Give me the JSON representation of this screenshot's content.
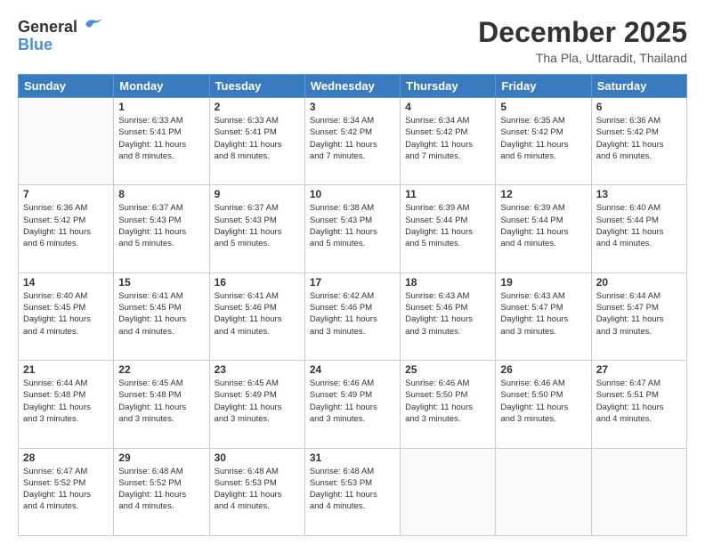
{
  "header": {
    "logo": {
      "general": "General",
      "blue": "Blue"
    },
    "title": "December 2025",
    "subtitle": "Tha Pla, Uttaradit, Thailand"
  },
  "calendar": {
    "days_of_week": [
      "Sunday",
      "Monday",
      "Tuesday",
      "Wednesday",
      "Thursday",
      "Friday",
      "Saturday"
    ],
    "weeks": [
      [
        {
          "day": "",
          "info": ""
        },
        {
          "day": "1",
          "info": "Sunrise: 6:33 AM\nSunset: 5:41 PM\nDaylight: 11 hours\nand 8 minutes."
        },
        {
          "day": "2",
          "info": "Sunrise: 6:33 AM\nSunset: 5:41 PM\nDaylight: 11 hours\nand 8 minutes."
        },
        {
          "day": "3",
          "info": "Sunrise: 6:34 AM\nSunset: 5:42 PM\nDaylight: 11 hours\nand 7 minutes."
        },
        {
          "day": "4",
          "info": "Sunrise: 6:34 AM\nSunset: 5:42 PM\nDaylight: 11 hours\nand 7 minutes."
        },
        {
          "day": "5",
          "info": "Sunrise: 6:35 AM\nSunset: 5:42 PM\nDaylight: 11 hours\nand 6 minutes."
        },
        {
          "day": "6",
          "info": "Sunrise: 6:36 AM\nSunset: 5:42 PM\nDaylight: 11 hours\nand 6 minutes."
        }
      ],
      [
        {
          "day": "7",
          "info": "Sunrise: 6:36 AM\nSunset: 5:42 PM\nDaylight: 11 hours\nand 6 minutes."
        },
        {
          "day": "8",
          "info": "Sunrise: 6:37 AM\nSunset: 5:43 PM\nDaylight: 11 hours\nand 5 minutes."
        },
        {
          "day": "9",
          "info": "Sunrise: 6:37 AM\nSunset: 5:43 PM\nDaylight: 11 hours\nand 5 minutes."
        },
        {
          "day": "10",
          "info": "Sunrise: 6:38 AM\nSunset: 5:43 PM\nDaylight: 11 hours\nand 5 minutes."
        },
        {
          "day": "11",
          "info": "Sunrise: 6:39 AM\nSunset: 5:44 PM\nDaylight: 11 hours\nand 5 minutes."
        },
        {
          "day": "12",
          "info": "Sunrise: 6:39 AM\nSunset: 5:44 PM\nDaylight: 11 hours\nand 4 minutes."
        },
        {
          "day": "13",
          "info": "Sunrise: 6:40 AM\nSunset: 5:44 PM\nDaylight: 11 hours\nand 4 minutes."
        }
      ],
      [
        {
          "day": "14",
          "info": "Sunrise: 6:40 AM\nSunset: 5:45 PM\nDaylight: 11 hours\nand 4 minutes."
        },
        {
          "day": "15",
          "info": "Sunrise: 6:41 AM\nSunset: 5:45 PM\nDaylight: 11 hours\nand 4 minutes."
        },
        {
          "day": "16",
          "info": "Sunrise: 6:41 AM\nSunset: 5:46 PM\nDaylight: 11 hours\nand 4 minutes."
        },
        {
          "day": "17",
          "info": "Sunrise: 6:42 AM\nSunset: 5:46 PM\nDaylight: 11 hours\nand 3 minutes."
        },
        {
          "day": "18",
          "info": "Sunrise: 6:43 AM\nSunset: 5:46 PM\nDaylight: 11 hours\nand 3 minutes."
        },
        {
          "day": "19",
          "info": "Sunrise: 6:43 AM\nSunset: 5:47 PM\nDaylight: 11 hours\nand 3 minutes."
        },
        {
          "day": "20",
          "info": "Sunrise: 6:44 AM\nSunset: 5:47 PM\nDaylight: 11 hours\nand 3 minutes."
        }
      ],
      [
        {
          "day": "21",
          "info": "Sunrise: 6:44 AM\nSunset: 5:48 PM\nDaylight: 11 hours\nand 3 minutes."
        },
        {
          "day": "22",
          "info": "Sunrise: 6:45 AM\nSunset: 5:48 PM\nDaylight: 11 hours\nand 3 minutes."
        },
        {
          "day": "23",
          "info": "Sunrise: 6:45 AM\nSunset: 5:49 PM\nDaylight: 11 hours\nand 3 minutes."
        },
        {
          "day": "24",
          "info": "Sunrise: 6:46 AM\nSunset: 5:49 PM\nDaylight: 11 hours\nand 3 minutes."
        },
        {
          "day": "25",
          "info": "Sunrise: 6:46 AM\nSunset: 5:50 PM\nDaylight: 11 hours\nand 3 minutes."
        },
        {
          "day": "26",
          "info": "Sunrise: 6:46 AM\nSunset: 5:50 PM\nDaylight: 11 hours\nand 3 minutes."
        },
        {
          "day": "27",
          "info": "Sunrise: 6:47 AM\nSunset: 5:51 PM\nDaylight: 11 hours\nand 4 minutes."
        }
      ],
      [
        {
          "day": "28",
          "info": "Sunrise: 6:47 AM\nSunset: 5:52 PM\nDaylight: 11 hours\nand 4 minutes."
        },
        {
          "day": "29",
          "info": "Sunrise: 6:48 AM\nSunset: 5:52 PM\nDaylight: 11 hours\nand 4 minutes."
        },
        {
          "day": "30",
          "info": "Sunrise: 6:48 AM\nSunset: 5:53 PM\nDaylight: 11 hours\nand 4 minutes."
        },
        {
          "day": "31",
          "info": "Sunrise: 6:48 AM\nSunset: 5:53 PM\nDaylight: 11 hours\nand 4 minutes."
        },
        {
          "day": "",
          "info": ""
        },
        {
          "day": "",
          "info": ""
        },
        {
          "day": "",
          "info": ""
        }
      ]
    ]
  }
}
